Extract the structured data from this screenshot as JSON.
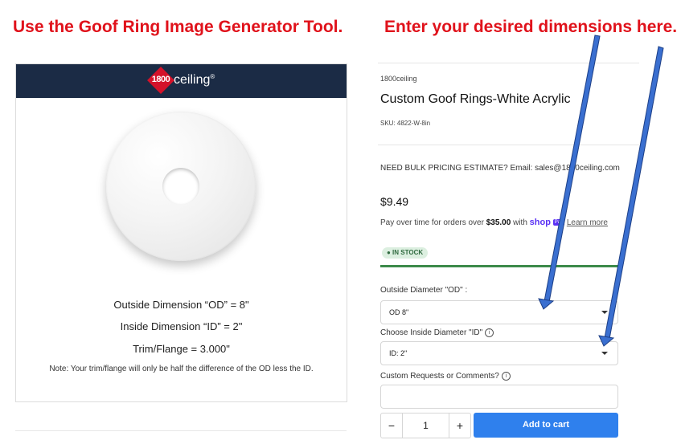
{
  "annotations": {
    "left": "Use the Goof Ring Image Generator Tool.",
    "right": "Enter your desired dimensions here."
  },
  "preview": {
    "logo_number": "1800",
    "logo_word": "ceiling",
    "logo_mark": "®",
    "outside_dimension": "Outside Dimension “OD” = 8\"",
    "inside_dimension": "Inside Dimension “ID” = 2\"",
    "trim_flange": "Trim/Flange = 3.000\"",
    "note": "Note: Your trim/flange will only be half the difference of the OD less the ID."
  },
  "product": {
    "brand": "1800ceiling",
    "title": "Custom Goof Rings-White Acrylic",
    "sku": "SKU: 4822-W-8in",
    "bulk_pricing": "NEED BULK PRICING ESTIMATE? Email: sales@1800ceiling.com",
    "price": "$9.49",
    "pay_over_prefix": "Pay over time for orders over ",
    "pay_over_amount": "$35.00",
    "pay_over_with": " with ",
    "shop_logo": "shop",
    "shop_pay_badge": "Pay",
    "learn_more": "Learn more",
    "stock_status": "● IN STOCK",
    "stock_color": "#3c8a4a"
  },
  "form": {
    "od_label": "Outside Diameter \"OD\" :",
    "od_value": "OD 8\"",
    "id_label": "Choose Inside Diameter \"ID\"",
    "id_value": "ID: 2\"",
    "comments_label": "Custom Requests or Comments?",
    "info_icon": "ⓘ",
    "quantity": "1",
    "minus": "−",
    "plus": "+",
    "add_to_cart": "Add to cart"
  },
  "colors": {
    "annotation_red": "#e0121b",
    "header_navy": "#1b2b45",
    "cart_blue": "#2f80ed",
    "arrow_blue": "#3a6fd0"
  }
}
